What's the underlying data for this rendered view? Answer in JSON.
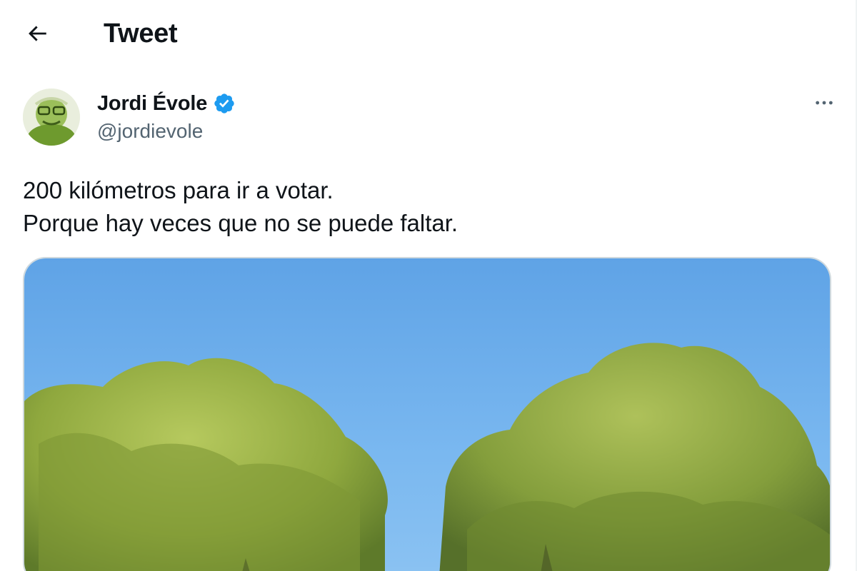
{
  "header": {
    "title": "Tweet",
    "back_icon": "arrow-left-icon"
  },
  "author": {
    "name": "Jordi Évole",
    "handle": "@jordievole",
    "verified": true,
    "verified_icon": "verified-badge-icon",
    "avatar_icon": "avatar-image"
  },
  "tweet": {
    "lines": [
      "200 kilómetros para ir a votar.",
      "Porque hay veces que no se puede faltar."
    ],
    "more_icon": "more-options-icon"
  },
  "media": {
    "type": "photo",
    "description_icon": "photo-trees-sky"
  },
  "colors": {
    "text_primary": "#0f1419",
    "text_secondary": "#536471",
    "verified_blue": "#1d9bf0",
    "border": "#cfd9de"
  }
}
